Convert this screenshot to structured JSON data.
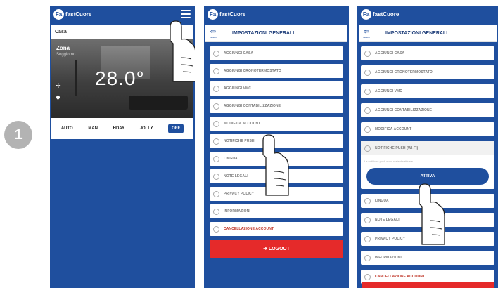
{
  "step_number": "1",
  "brand": {
    "logo_mark": "Fa",
    "logo_text": "fastCuore"
  },
  "screen1": {
    "home": "Casa",
    "room": "Zona",
    "room_sub": "Soggiorno",
    "temperature": "28.0°",
    "modes": [
      "AUTO",
      "MAN",
      "HDAY",
      "JOLLY",
      "OFF"
    ]
  },
  "settings": {
    "back_icon": "back-arrow-icon",
    "back_label": "indietro",
    "title": "IMPOSTAZIONI GENERALI",
    "items": [
      "AGGIUNGI CASA",
      "AGGIUNGI CRONOTERMOSTATO",
      "AGGIUNGI VMC",
      "AGGIUNGI CONTABILIZZAZIONE",
      "MODIFICA ACCOUNT",
      "NOTIFICHE PUSH",
      "LINGUA",
      "NOTE LEGALI",
      "PRIVACY POLICY",
      "INFORMAZIONI",
      "CANCELLAZIONE ACCOUNT"
    ],
    "logout": "LOGOUT"
  },
  "screen3": {
    "items_before": [
      "AGGIUNGI CASA",
      "AGGIUNGI CRONOTERMOSTATO",
      "AGGIUNGI VMC",
      "AGGIUNGI CONTABILIZZAZIONE",
      "MODIFICA ACCOUNT"
    ],
    "expanded_label": "NOTIFICHE PUSH (WI-FI)",
    "expanded_note": "Le notifiche push sono state disattivate",
    "activate_button": "ATTIVA",
    "items_after": [
      "LINGUA",
      "NOTE LEGALI",
      "PRIVACY POLICY",
      "INFORMAZIONI",
      "CANCELLAZIONE ACCOUNT"
    ]
  },
  "colors": {
    "primary": "#1f4f9e",
    "danger": "#e52a2a",
    "step_badge": "#b3b3b3"
  }
}
